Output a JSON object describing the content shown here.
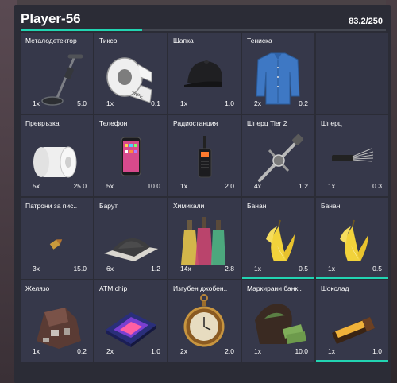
{
  "inventory": {
    "title": "Player-56",
    "weight": "83.2/250",
    "weight_fraction": 0.3328,
    "accent_color": "#22d4b2",
    "slots": [
      {
        "name": "Металодетектор",
        "qty": "1x",
        "weight": "5.0",
        "icon": "metal-detector-icon"
      },
      {
        "name": "Тиксо",
        "qty": "1x",
        "weight": "0.1",
        "icon": "duct-tape-icon"
      },
      {
        "name": "Шапка",
        "qty": "1x",
        "weight": "1.0",
        "icon": "cap-icon"
      },
      {
        "name": "Тениска",
        "qty": "2x",
        "weight": "0.2",
        "icon": "shirt-icon"
      },
      {
        "name": "",
        "qty": "",
        "weight": "",
        "icon": ""
      },
      {
        "name": "Превръзка",
        "qty": "5x",
        "weight": "25.0",
        "icon": "bandage-icon"
      },
      {
        "name": "Телефон",
        "qty": "5x",
        "weight": "10.0",
        "icon": "phone-icon"
      },
      {
        "name": "Радиостанция",
        "qty": "1x",
        "weight": "2.0",
        "icon": "radio-icon"
      },
      {
        "name": "Шперц Tier 2",
        "qty": "4x",
        "weight": "1.2",
        "icon": "lockpick-tier2-icon"
      },
      {
        "name": "Шперц",
        "qty": "1x",
        "weight": "0.3",
        "icon": "lockpick-icon"
      },
      {
        "name": "Патрони за пис..",
        "qty": "3x",
        "weight": "15.0",
        "icon": "pistol-ammo-icon"
      },
      {
        "name": "Барут",
        "qty": "6x",
        "weight": "1.2",
        "icon": "gunpowder-icon"
      },
      {
        "name": "Химикали",
        "qty": "14x",
        "weight": "2.8",
        "icon": "chemicals-icon"
      },
      {
        "name": "Банан",
        "qty": "1x",
        "weight": "0.5",
        "icon": "banana-icon"
      },
      {
        "name": "Банан",
        "qty": "1x",
        "weight": "0.5",
        "icon": "banana-icon"
      },
      {
        "name": "Желязо",
        "qty": "1x",
        "weight": "0.2",
        "icon": "iron-icon"
      },
      {
        "name": "ATM chip",
        "qty": "2x",
        "weight": "1.0",
        "icon": "atm-chip-icon"
      },
      {
        "name": "Изгубен джобен..",
        "qty": "2x",
        "weight": "2.0",
        "icon": "pocket-watch-icon"
      },
      {
        "name": "Маркирани банк..",
        "qty": "1x",
        "weight": "10.0",
        "icon": "marked-bills-icon"
      },
      {
        "name": "Шоколад",
        "qty": "1x",
        "weight": "1.0",
        "icon": "chocolate-icon"
      }
    ]
  }
}
